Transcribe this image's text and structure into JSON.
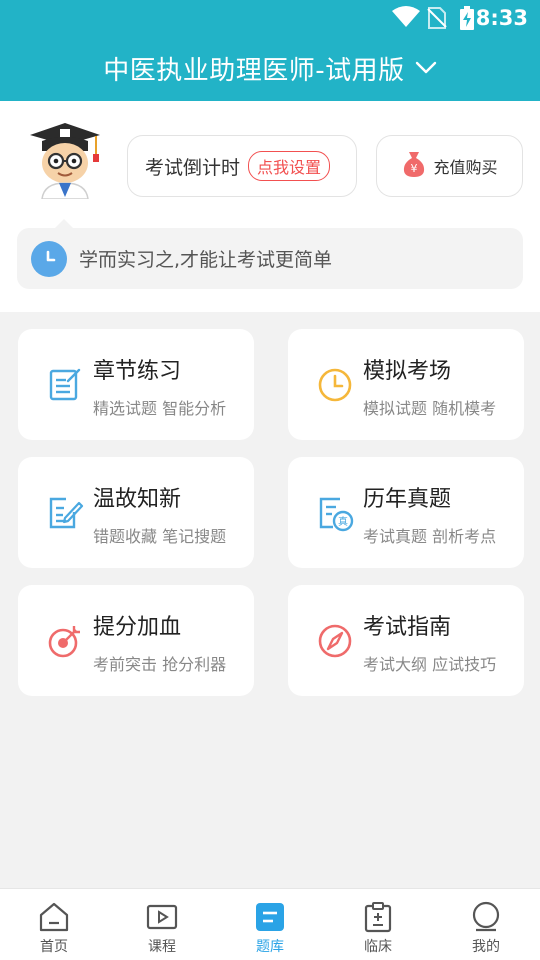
{
  "status_bar": {
    "time": "8:33"
  },
  "header": {
    "title": "中医执业助理医师-试用版"
  },
  "countdown": {
    "label": "考试倒计时",
    "action": "点我设置"
  },
  "recharge": {
    "label": "充值购买"
  },
  "motto": "学而实习之,才能让考试更简单",
  "cards": [
    {
      "title": "章节练习",
      "subtitle": "精选试题 智能分析",
      "icon": "edit-list-icon",
      "color": "#4aa8e0"
    },
    {
      "title": "模拟考场",
      "subtitle": "模拟试题 随机模考",
      "icon": "clock-icon",
      "color": "#f5b73a"
    },
    {
      "title": "温故知新",
      "subtitle": "错题收藏 笔记搜题",
      "icon": "note-pen-icon",
      "color": "#4aa8e0"
    },
    {
      "title": "历年真题",
      "subtitle": "考试真题 剖析考点",
      "icon": "exam-paper-icon",
      "color": "#4aa8e0"
    },
    {
      "title": "提分加血",
      "subtitle": "考前突击 抢分利器",
      "icon": "target-icon",
      "color": "#ef6b6b"
    },
    {
      "title": "考试指南",
      "subtitle": "考试大纲 应试技巧",
      "icon": "compass-icon",
      "color": "#ef6b6b"
    }
  ],
  "nav": [
    {
      "label": "首页",
      "icon": "home-icon"
    },
    {
      "label": "课程",
      "icon": "play-icon"
    },
    {
      "label": "题库",
      "icon": "question-bank-icon",
      "active": true
    },
    {
      "label": "临床",
      "icon": "clipboard-icon"
    },
    {
      "label": "我的",
      "icon": "profile-icon"
    }
  ],
  "colors": {
    "primary": "#22b3c7",
    "accent_blue": "#2aa3e6",
    "warn_red": "#f25050"
  }
}
